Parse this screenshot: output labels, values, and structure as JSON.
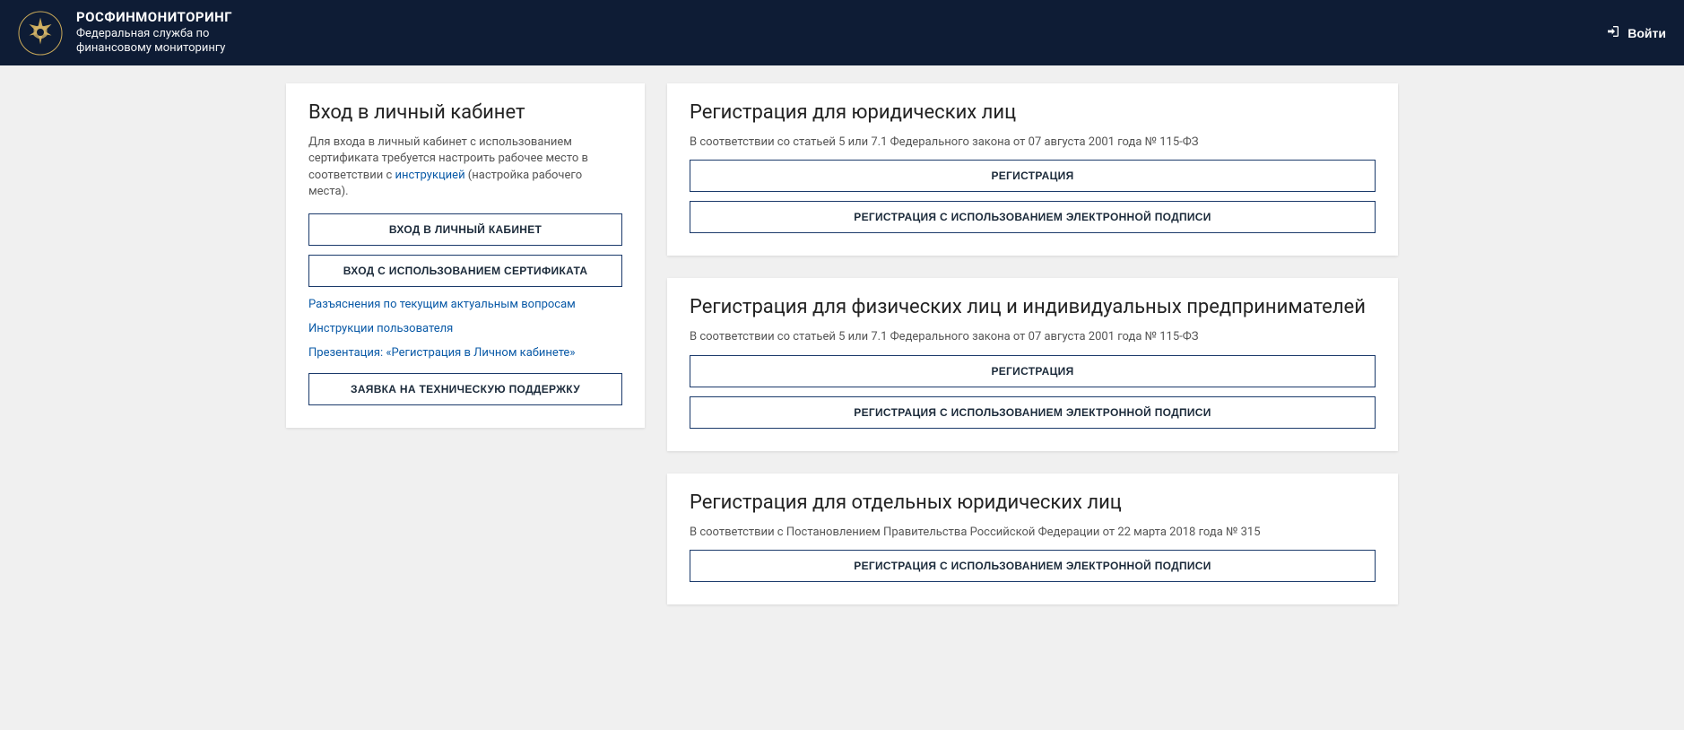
{
  "header": {
    "title": "РОСФИНМОНИТОРИНГ",
    "subtitle1": "Федеральная служба по",
    "subtitle2": "финансовому мониторингу",
    "login_label": "Войти"
  },
  "login_card": {
    "title": "Вход в личный кабинет",
    "description_pre": "Для входа в личный кабинет с использованием сертификата требуется настроить рабочее место в соответствии с ",
    "instruction_link": "инструкцией",
    "description_post": " (настройка рабочего места).",
    "btn_login": "ВХОД В ЛИЧНЫЙ КАБИНЕТ",
    "btn_cert": "ВХОД С ИСПОЛЬЗОВАНИЕМ СЕРТИФИКАТА",
    "link_faq": "Разъяснения по текущим актуальным вопросам",
    "link_manual": "Инструкции пользователя",
    "link_presentation": "Презентация: «Регистрация в Личном кабинете»",
    "btn_support": "ЗАЯВКА НА ТЕХНИЧЕСКУЮ ПОДДЕРЖКУ"
  },
  "reg_legal": {
    "title": "Регистрация для юридических лиц",
    "description": "В соответствии со статьей 5 или 7.1 Федерального закона от 07 августа 2001 года № 115-ФЗ",
    "btn_register": "РЕГИСТРАЦИЯ",
    "btn_register_sig": "РЕГИСТРАЦИЯ С ИСПОЛЬЗОВАНИЕМ ЭЛЕКТРОННОЙ ПОДПИСИ"
  },
  "reg_individual": {
    "title": "Регистрация для физических лиц и индивидуальных предпринимателей",
    "description": "В соответствии со статьей 5 или 7.1 Федерального закона от 07 августа 2001 года № 115-ФЗ",
    "btn_register": "РЕГИСТРАЦИЯ",
    "btn_register_sig": "РЕГИСТРАЦИЯ С ИСПОЛЬЗОВАНИЕМ ЭЛЕКТРОННОЙ ПОДПИСИ"
  },
  "reg_special": {
    "title": "Регистрация для отдельных юридических лиц",
    "description": "В соответствии с Постановлением Правительства Российской Федерации от 22 марта 2018 года № 315",
    "btn_register_sig": "РЕГИСТРАЦИЯ С ИСПОЛЬЗОВАНИЕМ ЭЛЕКТРОННОЙ ПОДПИСИ"
  }
}
